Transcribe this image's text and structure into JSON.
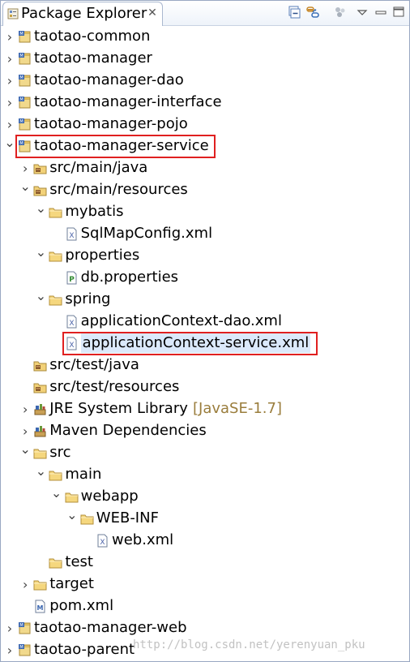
{
  "panel": {
    "title": "Package Explorer",
    "close_symbol": "✕",
    "toolbar": [
      {
        "icon": "collapse-all-icon"
      },
      {
        "icon": "link-with-editor-icon"
      },
      {
        "icon": "focus-active-task-icon"
      },
      {
        "icon": "view-menu-icon"
      },
      {
        "icon": "minimize-icon"
      },
      {
        "icon": "maximize-icon"
      }
    ]
  },
  "tree": [
    {
      "label": "taotao-common",
      "icon": "maven-project-icon",
      "level": 0,
      "twisty": "collapsed"
    },
    {
      "label": "taotao-manager",
      "icon": "maven-project-icon",
      "level": 0,
      "twisty": "collapsed"
    },
    {
      "label": "taotao-manager-dao",
      "icon": "maven-project-icon",
      "level": 0,
      "twisty": "collapsed"
    },
    {
      "label": "taotao-manager-interface",
      "icon": "maven-project-icon",
      "level": 0,
      "twisty": "collapsed"
    },
    {
      "label": "taotao-manager-pojo",
      "icon": "maven-project-icon",
      "level": 0,
      "twisty": "collapsed"
    },
    {
      "label": "taotao-manager-service",
      "icon": "maven-project-icon",
      "level": 0,
      "twisty": "expanded",
      "highlighted": true
    },
    {
      "label": "src/main/java",
      "icon": "source-folder-icon",
      "level": 1,
      "twisty": "collapsed"
    },
    {
      "label": "src/main/resources",
      "icon": "source-folder-icon",
      "level": 1,
      "twisty": "expanded"
    },
    {
      "label": "mybatis",
      "icon": "folder-icon",
      "level": 2,
      "twisty": "expanded"
    },
    {
      "label": "SqlMapConfig.xml",
      "icon": "xml-file-icon",
      "level": 3,
      "twisty": "none"
    },
    {
      "label": "properties",
      "icon": "folder-icon",
      "level": 2,
      "twisty": "expanded"
    },
    {
      "label": "db.properties",
      "icon": "properties-file-icon",
      "level": 3,
      "twisty": "none"
    },
    {
      "label": "spring",
      "icon": "folder-icon",
      "level": 2,
      "twisty": "expanded"
    },
    {
      "label": "applicationContext-dao.xml",
      "icon": "xml-file-icon",
      "level": 3,
      "twisty": "none"
    },
    {
      "label": "applicationContext-service.xml",
      "icon": "xml-file-icon",
      "level": 3,
      "twisty": "none",
      "highlighted": true,
      "selected": true
    },
    {
      "label": "src/test/java",
      "icon": "source-folder-icon",
      "level": 1,
      "twisty": "none"
    },
    {
      "label": "src/test/resources",
      "icon": "source-folder-icon",
      "level": 1,
      "twisty": "none"
    },
    {
      "label": "JRE System Library",
      "decoration": "[JavaSE-1.7]",
      "icon": "library-icon",
      "level": 1,
      "twisty": "collapsed"
    },
    {
      "label": "Maven Dependencies",
      "icon": "library-icon",
      "level": 1,
      "twisty": "collapsed"
    },
    {
      "label": "src",
      "icon": "folder-icon",
      "level": 1,
      "twisty": "expanded"
    },
    {
      "label": "main",
      "icon": "folder-icon",
      "level": 2,
      "twisty": "expanded"
    },
    {
      "label": "webapp",
      "icon": "folder-icon",
      "level": 3,
      "twisty": "expanded"
    },
    {
      "label": "WEB-INF",
      "icon": "folder-icon",
      "level": 4,
      "twisty": "expanded"
    },
    {
      "label": "web.xml",
      "icon": "xml-file-icon",
      "level": 5,
      "twisty": "none"
    },
    {
      "label": "test",
      "icon": "folder-icon",
      "level": 2,
      "twisty": "none"
    },
    {
      "label": "target",
      "icon": "folder-icon",
      "level": 1,
      "twisty": "collapsed"
    },
    {
      "label": "pom.xml",
      "icon": "maven-pom-icon",
      "level": 1,
      "twisty": "none"
    },
    {
      "label": "taotao-manager-web",
      "icon": "maven-project-icon",
      "level": 0,
      "twisty": "collapsed"
    },
    {
      "label": "taotao-parent",
      "icon": "maven-project-icon",
      "level": 0,
      "twisty": "collapsed"
    }
  ],
  "watermark": "http://blog.csdn.net/yerenyuan_pku",
  "colors": {
    "highlight_border": "#e02020",
    "selection": "#dbe9fb",
    "decoration_text": "#9a7d3c"
  }
}
